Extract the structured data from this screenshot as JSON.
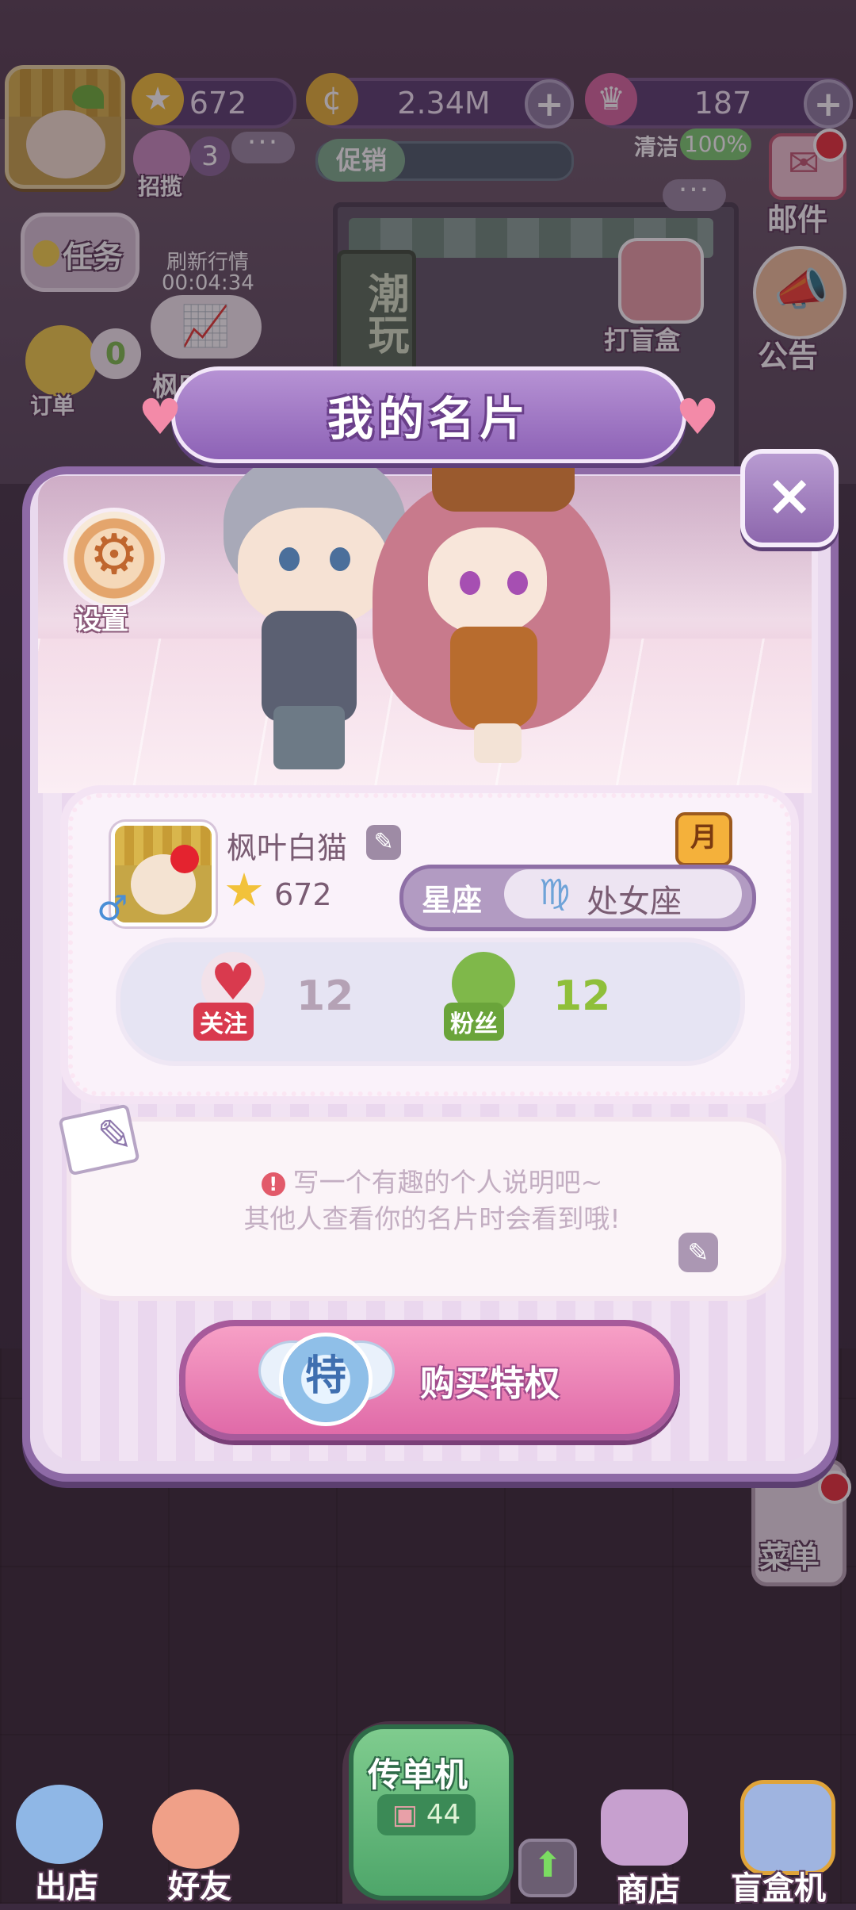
{
  "hud": {
    "stars": "672",
    "coins": "2.34M",
    "crowns": "187",
    "recruit_label": "招揽",
    "recruit_count": "3",
    "promo_label": "促销",
    "clean_label": "清洁",
    "clean_value": "100%",
    "more_dots": "···"
  },
  "side_left": {
    "task": "任务",
    "refresh_title": "刷新行情",
    "refresh_timer": "00:04:34",
    "order": "订单",
    "order_count": "0",
    "shop_name": "枫叶白猫"
  },
  "side_right": {
    "mail": "邮件",
    "blind_box": "打盲盒",
    "notice": "公告",
    "menu": "菜单"
  },
  "scene": {
    "sign_text": "潮玩"
  },
  "modal": {
    "title": "我的名片",
    "close": "×",
    "settings_label": "设置",
    "settings_icon": "⚙"
  },
  "profile": {
    "name": "枫叶白猫",
    "level": "672",
    "gender_symbol": "♂",
    "month_badge": "月",
    "zodiac_label": "星座",
    "zodiac_symbol": "♍",
    "zodiac_value": "处女座",
    "following_label": "关注",
    "following_count": "12",
    "fans_label": "粉丝",
    "fans_count": "12"
  },
  "description": {
    "warn_symbol": "!",
    "line1": "写一个有趣的个人说明吧~",
    "line2": "其他人查看你的名片时会看到哦!",
    "edit_symbol": "✎"
  },
  "buy": {
    "badge": "特",
    "label": "购买特权"
  },
  "bottom": {
    "out_store": "出店",
    "friends": "好友",
    "flyer": "传单机",
    "flyer_count": "44",
    "store": "商店",
    "blindbox_machine": "盲盒机",
    "up_arrow": "⬆"
  },
  "colors": {
    "modal_border": "#8e6aa6",
    "buy_button": "#e06aa8",
    "flyer_green": "#4ea66a"
  }
}
